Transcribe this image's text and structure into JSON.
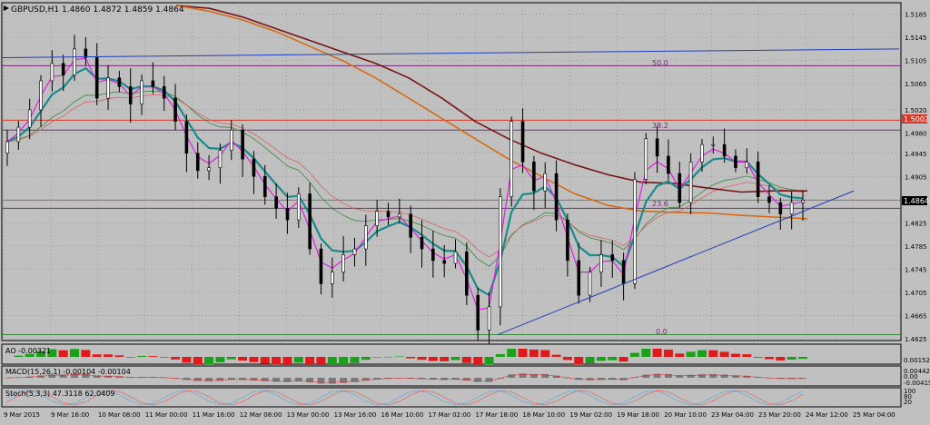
{
  "colors": {
    "bg": "#c0c0c0",
    "grid": "#7a7a7a",
    "axis": "#000000",
    "bull_candle": "#000000",
    "bear_candle": "#000000",
    "blue_line": "#1f3fb8",
    "purple": "#7a2a7a",
    "red_level": "#d43a2a",
    "maroon_ma": "#7a1414",
    "orange_ma": "#d46a14",
    "teal_ma": "#1a8a8a",
    "magenta_ma": "#e020e0",
    "green_ma": "#3a8a3a",
    "salmon_ma": "#d46464",
    "ao_up": "#1aa01a",
    "ao_down": "#e01a1a",
    "macd_bar": "#7a7a7a",
    "macd_signal": "#e01a1a",
    "stoch_main": "#4aa0e0",
    "stoch_signal": "#e01a1a",
    "price_label_bg": "#000000",
    "red_label_bg": "#d43a2a"
  },
  "header": {
    "symbol_label": "GBPUSD,H1  1.4860 1.4872 1.4859 1.4864"
  },
  "fib_labels": {
    "fib_50": "50.0",
    "fib_38": "38.2",
    "fib_23": "23.6",
    "fib_0": "0.0"
  },
  "price_labels": {
    "red_level": "1.5002",
    "current": "1.4864"
  },
  "indicators": {
    "ao_label": "AO -0.00321",
    "ao_scale": [
      "0.001524"
    ],
    "macd_label": "MACD(15,26,1) -0.00104 -0.00104",
    "macd_scale": [
      "0.00442",
      "0.00",
      "-0.00419"
    ],
    "stoch_label": "Stoch(5,3,3) 47.3118 62.0409",
    "stoch_scale": [
      "100",
      "80",
      "20",
      "0"
    ]
  },
  "chart_data": {
    "type": "candlestick",
    "symbol": "GBPUSD",
    "timeframe": "H1",
    "ohlc_last": {
      "open": 1.486,
      "high": 1.4872,
      "low": 1.4859,
      "close": 1.4864
    },
    "y_ticks": [
      "1.5185",
      "1.5145",
      "1.5105",
      "1.5065",
      "1.5020",
      "1.4980",
      "1.4945",
      "1.4905",
      "1.4865",
      "1.4825",
      "1.4785",
      "1.4745",
      "1.4705",
      "1.4665",
      "1.4625"
    ],
    "ylim": [
      1.4625,
      1.52
    ],
    "x_labels": [
      "9 Mar 2015",
      "9 Mar 16:00",
      "10 Mar 08:00",
      "11 Mar 00:00",
      "11 Mar 16:00",
      "12 Mar 08:00",
      "13 Mar 00:00",
      "13 Mar 16:00",
      "16 Mar 10:00",
      "17 Mar 02:00",
      "17 Mar 18:00",
      "18 Mar 10:00",
      "19 Mar 02:00",
      "19 Mar 18:00",
      "20 Mar 10:00",
      "23 Mar 04:00",
      "23 Mar 20:00",
      "24 Mar 12:00",
      "25 Mar 04:00"
    ],
    "close_series": [
      1.4965,
      1.499,
      1.502,
      1.507,
      1.51,
      1.508,
      1.5125,
      1.511,
      1.504,
      1.5075,
      1.506,
      1.503,
      1.507,
      1.506,
      1.504,
      1.5,
      1.4945,
      1.4915,
      1.492,
      1.495,
      1.4985,
      1.4935,
      1.4905,
      1.487,
      1.485,
      1.483,
      1.4875,
      1.478,
      1.472,
      1.474,
      1.477,
      1.478,
      1.482,
      1.4845,
      1.4835,
      1.484,
      1.48,
      1.478,
      1.476,
      1.4755,
      1.4775,
      1.47,
      1.464,
      1.468,
      1.487,
      1.5,
      1.493,
      1.488,
      1.491,
      1.483,
      1.476,
      1.47,
      1.474,
      1.477,
      1.476,
      1.472,
      1.49,
      1.497,
      1.494,
      1.491,
      1.486,
      1.493,
      1.496,
      1.496,
      1.494,
      1.492,
      1.493,
      1.487,
      1.486,
      1.484,
      1.486,
      1.4864
    ],
    "horizontal_levels": [
      {
        "name": "fib-50",
        "value": 1.5096
      },
      {
        "name": "red-level",
        "value": 1.5002
      },
      {
        "name": "fib-38",
        "value": 1.4985
      },
      {
        "name": "current",
        "value": 1.4864
      },
      {
        "name": "fib-23",
        "value": 1.485
      },
      {
        "name": "fib-0",
        "value": 1.4632
      }
    ],
    "trendlines": [
      {
        "name": "blue-upper",
        "from": {
          "bar": 0,
          "price": 1.511
        },
        "to": {
          "bar": 80,
          "price": 1.5125
        }
      },
      {
        "name": "blue-support",
        "from": {
          "bar": 44,
          "price": 1.4632
        },
        "to": {
          "bar": 80,
          "price": 1.488
        }
      }
    ],
    "moving_averages": [
      {
        "name": "maroon",
        "values": [
          1.52,
          1.5195,
          1.518,
          1.516,
          1.514,
          1.512,
          1.51,
          1.5075,
          1.504,
          1.5,
          1.497,
          1.4945,
          1.4925,
          1.4908,
          1.4895,
          1.4893,
          1.4885,
          1.4878,
          1.488,
          1.488
        ]
      },
      {
        "name": "orange",
        "values": [
          1.52,
          1.519,
          1.5175,
          1.5155,
          1.513,
          1.5105,
          1.5075,
          1.504,
          1.5005,
          1.497,
          1.4935,
          1.4905,
          1.4875,
          1.4855,
          1.4845,
          1.4843,
          1.4842,
          1.4838,
          1.4835,
          1.4832
        ]
      }
    ],
    "grid": true
  }
}
